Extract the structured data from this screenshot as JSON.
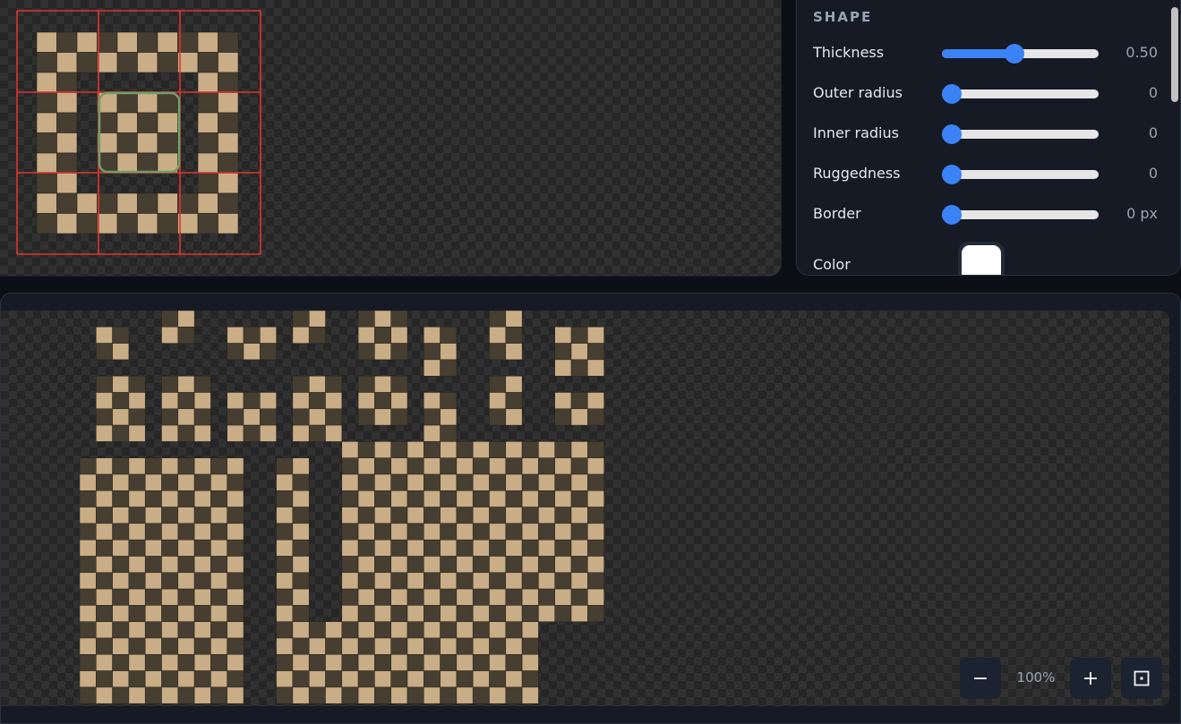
{
  "shape": {
    "title": "SHAPE",
    "thickness": {
      "label": "Thickness",
      "value_text": "0.50",
      "fraction": 0.46
    },
    "outer_radius": {
      "label": "Outer radius",
      "value_text": "0",
      "fraction": 0.0
    },
    "inner_radius": {
      "label": "Inner radius",
      "value_text": "0",
      "fraction": 0.0
    },
    "ruggedness": {
      "label": "Ruggedness",
      "value_text": "0",
      "fraction": 0.0
    },
    "border": {
      "label": "Border",
      "value_text": "0 px",
      "fraction": 0.0
    },
    "color": {
      "label": "Color",
      "value": "#ffffff"
    }
  },
  "zoom": {
    "level_text": "100%",
    "minus_icon": "minus-icon",
    "plus_icon": "plus-icon",
    "fit_icon": "fit-to-screen-icon"
  },
  "colors": {
    "accent": "#3b82f6",
    "grid_line": "#e0342f",
    "selection": "#6fa06a",
    "tile_light": "#c9ad86",
    "tile_dark": "#463e31",
    "tile_highlight": "#d7b98a"
  }
}
